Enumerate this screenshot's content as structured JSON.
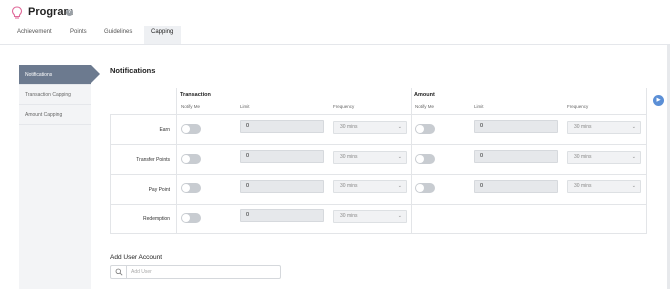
{
  "header": {
    "title": "Program"
  },
  "tabs": [
    "Achievement",
    "Points",
    "Guidelines",
    "Capping"
  ],
  "sidebar": {
    "items": [
      "Notifications",
      "Transaction Capping",
      "Amount Capping"
    ]
  },
  "section": {
    "title": "Notifications"
  },
  "groups": {
    "transaction": "Transaction",
    "amount": "Amount"
  },
  "columns": {
    "notify": "Notify Me",
    "limit": "Limit",
    "frequency": "Frequency"
  },
  "rows": [
    {
      "label": "Earn",
      "transaction": {
        "limit": "0",
        "frequency": "30 mins"
      },
      "amount": {
        "limit": "0",
        "frequency": "30 mins"
      }
    },
    {
      "label": "Transfer Points",
      "transaction": {
        "limit": "0",
        "frequency": "30 mins"
      },
      "amount": {
        "limit": "0",
        "frequency": "30 mins"
      }
    },
    {
      "label": "Pay Point",
      "transaction": {
        "limit": "0",
        "frequency": "30 mins"
      },
      "amount": {
        "limit": "0",
        "frequency": "30 mins"
      }
    },
    {
      "label": "Redemption",
      "transaction": {
        "limit": "0",
        "frequency": "30 mins"
      }
    }
  ],
  "add_user": {
    "title": "Add User Account",
    "placeholder": "Add User"
  },
  "icons": {
    "logo": "lightbulb-icon",
    "help": "help-icon",
    "search": "search-icon",
    "chevron": "chevron-down-icon"
  },
  "colors": {
    "active_sidebar": "#6c7a8f",
    "toggle_off": "#c8ccd1",
    "float_button": "#5b8fd6"
  }
}
